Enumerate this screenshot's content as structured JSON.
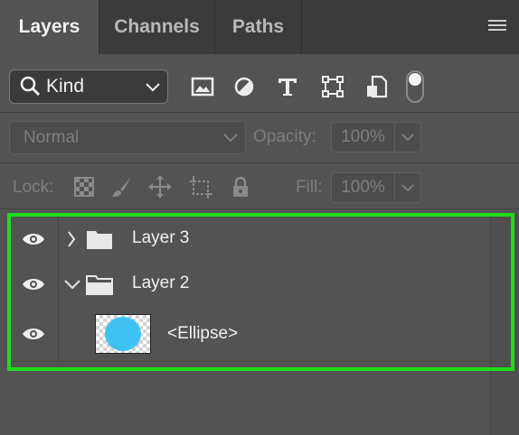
{
  "tabs": [
    {
      "label": "Layers",
      "active": true
    },
    {
      "label": "Channels",
      "active": false
    },
    {
      "label": "Paths",
      "active": false
    }
  ],
  "filter": {
    "kind_label": "Kind",
    "icons": [
      "image-filter-icon",
      "adjustment-filter-icon",
      "type-filter-icon",
      "shape-filter-icon",
      "smart-object-filter-icon",
      "filter-toggle-switch"
    ]
  },
  "blend": {
    "mode": "Normal",
    "opacity_label": "Opacity:",
    "opacity_value": "100%"
  },
  "lock": {
    "label": "Lock:",
    "fill_label": "Fill:",
    "fill_value": "100%"
  },
  "layers": [
    {
      "name": "Layer 3",
      "type": "group",
      "expanded": false
    },
    {
      "name": "Layer 2",
      "type": "group",
      "expanded": true
    },
    {
      "name": "<Ellipse>",
      "type": "shape",
      "thumb_color": "#3fc1f4"
    }
  ],
  "colors": {
    "highlight_outline": "#1cdc1c",
    "ellipse_fill": "#3fc1f4"
  }
}
